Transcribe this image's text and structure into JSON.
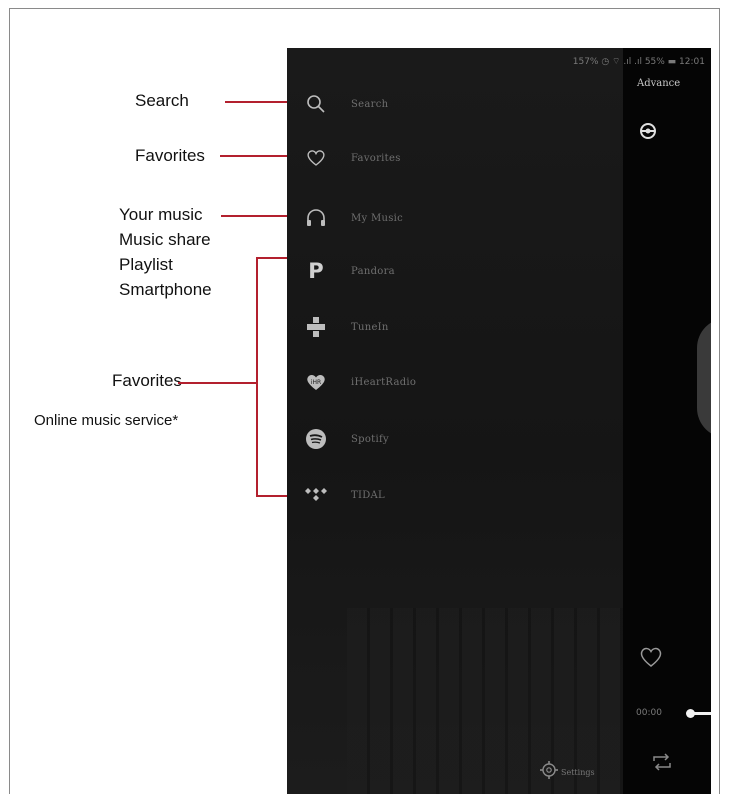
{
  "annotations": {
    "search": "Search",
    "favorites_top": "Favorites",
    "your_music": "Your music",
    "music_share": "Music share",
    "playlist": "Playlist",
    "smartphone": "Smartphone",
    "favorites_bottom": "Favorites",
    "online_music": "Online music service*"
  },
  "status_bar": {
    "text": "157% ◷ ⌔ .ıl .ıl 55% ▬ 12:01"
  },
  "menu": [
    {
      "label": "Search",
      "icon": "search-icon"
    },
    {
      "label": "Favorites",
      "icon": "heart-icon"
    },
    {
      "label": "My Music",
      "icon": "headphones-icon"
    },
    {
      "label": "Pandora",
      "icon": "pandora-icon"
    },
    {
      "label": "TuneIn",
      "icon": "tunein-icon"
    },
    {
      "label": "iHeartRadio",
      "icon": "iheartradio-icon"
    },
    {
      "label": "Spotify",
      "icon": "spotify-icon"
    },
    {
      "label": "TIDAL",
      "icon": "tidal-icon"
    }
  ],
  "player": {
    "advance": "Advance",
    "time": "00:00",
    "settings_label": "Settings"
  },
  "colors": {
    "accent_line": "#b3202e",
    "drawer_bg": "#1a1a1a"
  }
}
